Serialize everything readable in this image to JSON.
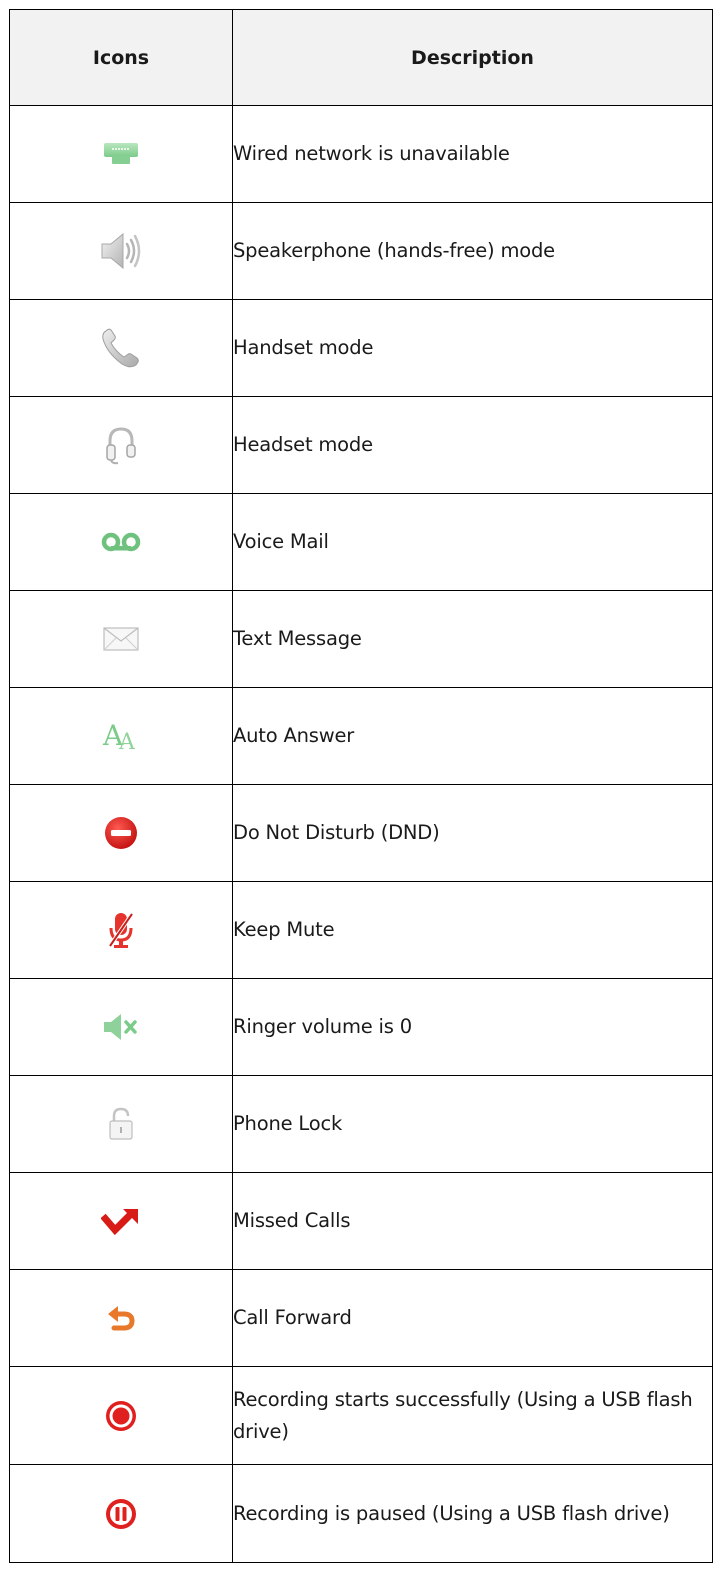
{
  "table": {
    "headers": {
      "icons": "Icons",
      "description": "Description"
    },
    "rows": [
      {
        "icon": "wired-network-unavailable-icon",
        "description": "Wired network is unavailable"
      },
      {
        "icon": "speakerphone-icon",
        "description": "Speakerphone (hands-free) mode"
      },
      {
        "icon": "handset-icon",
        "description": "Handset mode"
      },
      {
        "icon": "headset-icon",
        "description": "Headset mode"
      },
      {
        "icon": "voice-mail-icon",
        "description": "Voice Mail"
      },
      {
        "icon": "text-message-icon",
        "description": "Text Message"
      },
      {
        "icon": "auto-answer-icon",
        "description": "Auto Answer"
      },
      {
        "icon": "do-not-disturb-icon",
        "description": "Do Not Disturb (DND)"
      },
      {
        "icon": "keep-mute-icon",
        "description": "Keep Mute"
      },
      {
        "icon": "ringer-volume-zero-icon",
        "description": "Ringer volume is 0"
      },
      {
        "icon": "phone-lock-icon",
        "description": "Phone Lock"
      },
      {
        "icon": "missed-calls-icon",
        "description": "Missed Calls"
      },
      {
        "icon": "call-forward-icon",
        "description": "Call Forward"
      },
      {
        "icon": "recording-started-icon",
        "description": "Recording starts successfully (Using a USB flash drive)"
      },
      {
        "icon": "recording-paused-icon",
        "description": "Recording is paused (Using a USB flash drive)"
      }
    ]
  },
  "colors": {
    "header_bg": "#f2f2f2",
    "border": "#000000",
    "icon_green": "#8fd19a",
    "icon_gray": "#bdbdbd",
    "icon_red": "#e0201e",
    "icon_orange": "#e8782a"
  }
}
